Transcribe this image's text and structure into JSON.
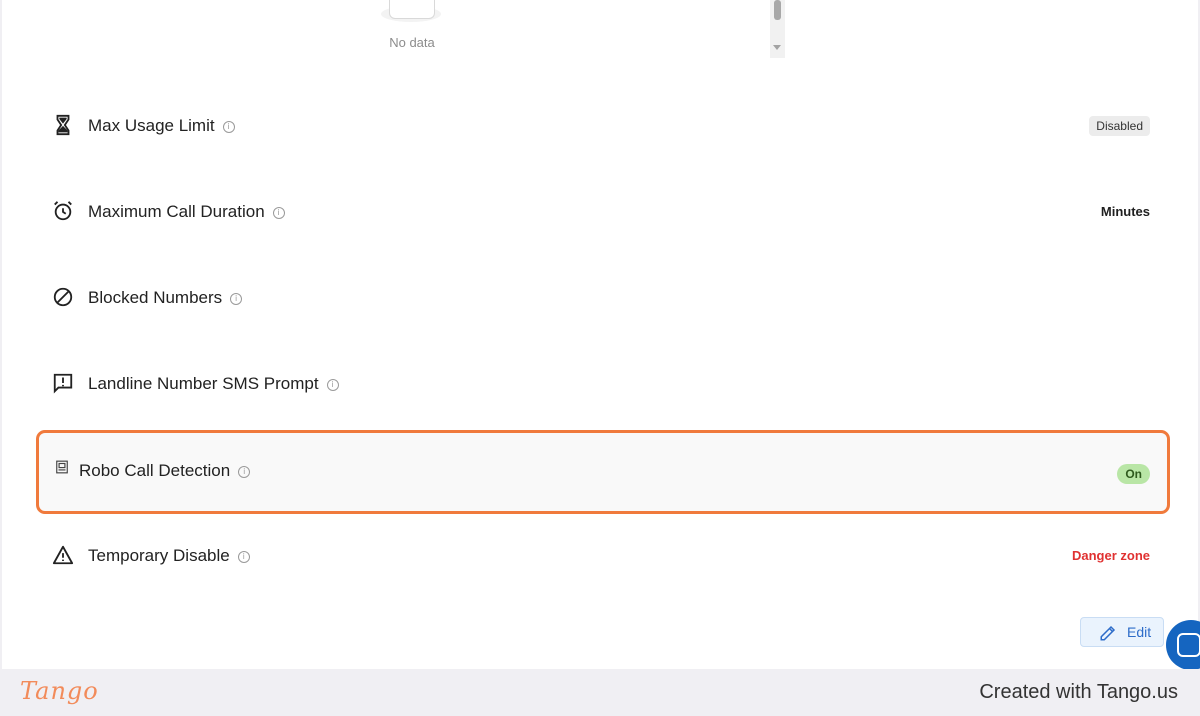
{
  "empty_state": {
    "text": "No data"
  },
  "settings": [
    {
      "id": "max-usage-limit",
      "label": "Max Usage Limit",
      "icon": "hourglass-icon",
      "value": "Disabled",
      "value_style": "badge-gray"
    },
    {
      "id": "maximum-call-duration",
      "label": "Maximum Call Duration",
      "icon": "alarm-clock-icon",
      "value": "Minutes",
      "value_style": "bold-text"
    },
    {
      "id": "blocked-numbers",
      "label": "Blocked Numbers",
      "icon": "block-icon",
      "value": "",
      "value_style": "none"
    },
    {
      "id": "landline-number-sms-prompt",
      "label": "Landline Number SMS Prompt",
      "icon": "message-alert-icon",
      "value": "",
      "value_style": "none"
    },
    {
      "id": "robo-call-detection",
      "label": "Robo Call Detection",
      "icon": "robot-icon",
      "value": "On",
      "value_style": "badge-green",
      "highlighted": true
    },
    {
      "id": "temporary-disable",
      "label": "Temporary Disable",
      "icon": "warning-icon",
      "value": "Danger zone",
      "value_style": "danger-text"
    }
  ],
  "edit_button": {
    "label": "Edit"
  },
  "footer": {
    "logo": "Tango",
    "credit": "Created with Tango.us"
  },
  "colors": {
    "highlight_border": "#f07a3c",
    "danger": "#e03131",
    "on_badge": "#b9e6a6",
    "accent_blue": "#2d6cc9"
  }
}
